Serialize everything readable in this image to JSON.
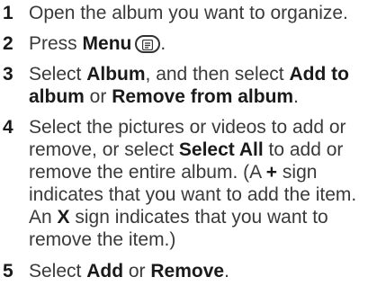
{
  "steps": [
    {
      "number": "1",
      "text": "Open the album you want to organize."
    },
    {
      "number": "2",
      "prefix": "Press ",
      "bold": "Menu",
      "suffix": ".",
      "icon": "menu-key-icon"
    },
    {
      "number": "3",
      "prefix": "Select ",
      "bold1": "Album",
      "middle1": ", and then select ",
      "bold2": "Add to",
      "bold2b": "album",
      "middle2": " or ",
      "bold3": "Remove from album",
      "suffix": "."
    },
    {
      "number": "4",
      "line1": "Select the pictures or videos to add or",
      "line2a": "remove, or select ",
      "line2b": "Select All",
      "line2c": " to add or",
      "line3": "remove the entire album. (A ",
      "line3b": "+",
      "line3c": " sign",
      "line4": "indicates that you want to add the item.",
      "line5a": "An ",
      "line5b": "X",
      "line5c": " sign indicates that you want to",
      "line6": "remove the item.)"
    },
    {
      "number": "5",
      "prefix": "Select ",
      "bold1": "Add",
      "middle": " or ",
      "bold2": "Remove",
      "suffix": "."
    }
  ]
}
